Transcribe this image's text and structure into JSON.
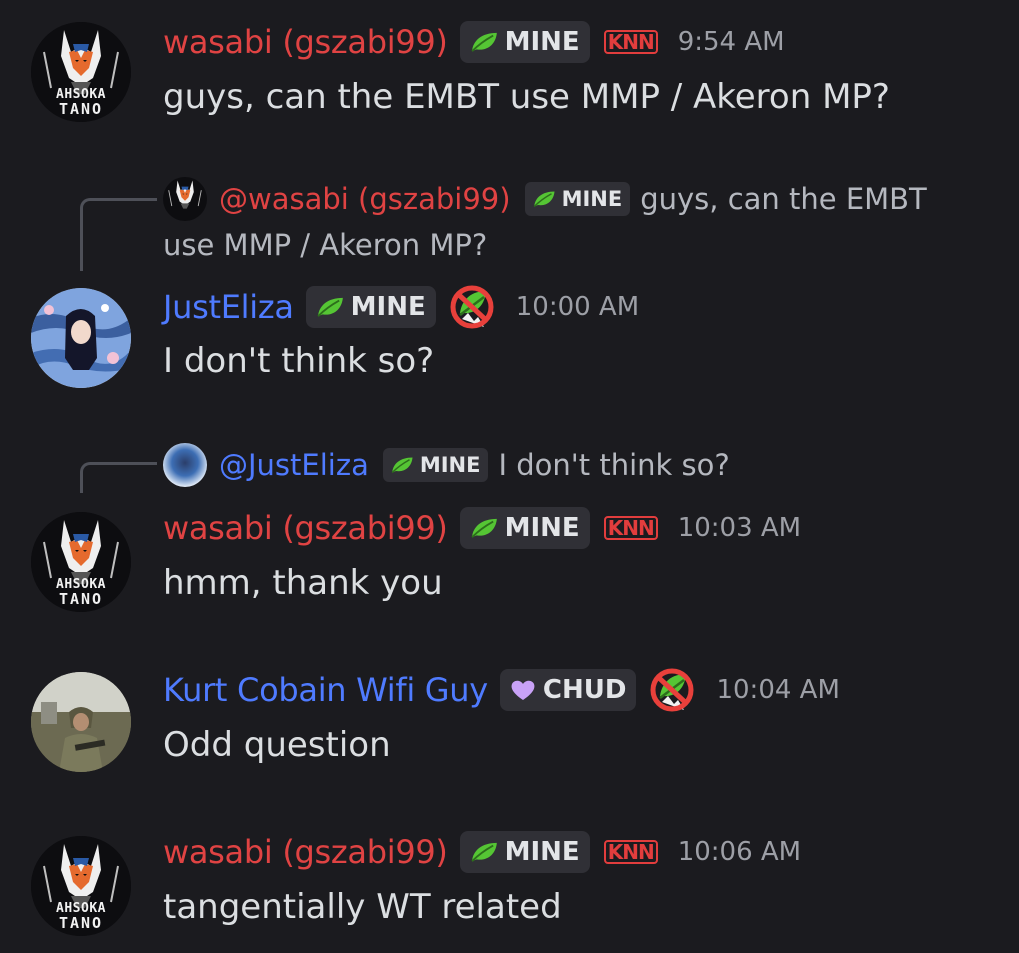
{
  "messages": [
    {
      "author": "wasabi (gszabi99)",
      "tag": "MINE",
      "badge": "KNN",
      "time": "9:54 AM",
      "text": "guys, can the EMBT use MMP / Akeron MP?"
    },
    {
      "reply": {
        "author": "@wasabi (gszabi99)",
        "tag": "MINE",
        "text_line1": "guys, can the EMBT",
        "text_line2": "use MMP / Akeron MP?"
      },
      "author": "JustEliza",
      "tag": "MINE",
      "time": "10:00 AM",
      "text": "I don't think so?"
    },
    {
      "reply": {
        "author": "@JustEliza",
        "tag": "MINE",
        "text": "I don't think so?"
      },
      "author": "wasabi (gszabi99)",
      "tag": "MINE",
      "badge": "KNN",
      "time": "10:03 AM",
      "text": "hmm, thank you"
    },
    {
      "author": "Kurt Cobain Wifi Guy",
      "tag": "CHUD",
      "time": "10:04 AM",
      "text": "Odd question"
    },
    {
      "author": "wasabi (gszabi99)",
      "tag": "MINE",
      "badge": "KNN",
      "time": "10:06 AM",
      "text": "tangentially WT related"
    }
  ],
  "avatar_text": {
    "line1": "AHSOKA",
    "line2": "TANO"
  },
  "colors": {
    "background": "#1b1b1f",
    "name_red": "#e04343",
    "name_blue": "#4f7bff",
    "tag_bg": "#303036",
    "leaf_green": "#55c534",
    "heart_purple": "#c9a2f7",
    "timestamp": "#9d9fa6"
  },
  "icons": {
    "mine_tag": "leaf-icon",
    "chud_tag": "heart-icon",
    "no_leaf": "no-leaf-icon"
  }
}
